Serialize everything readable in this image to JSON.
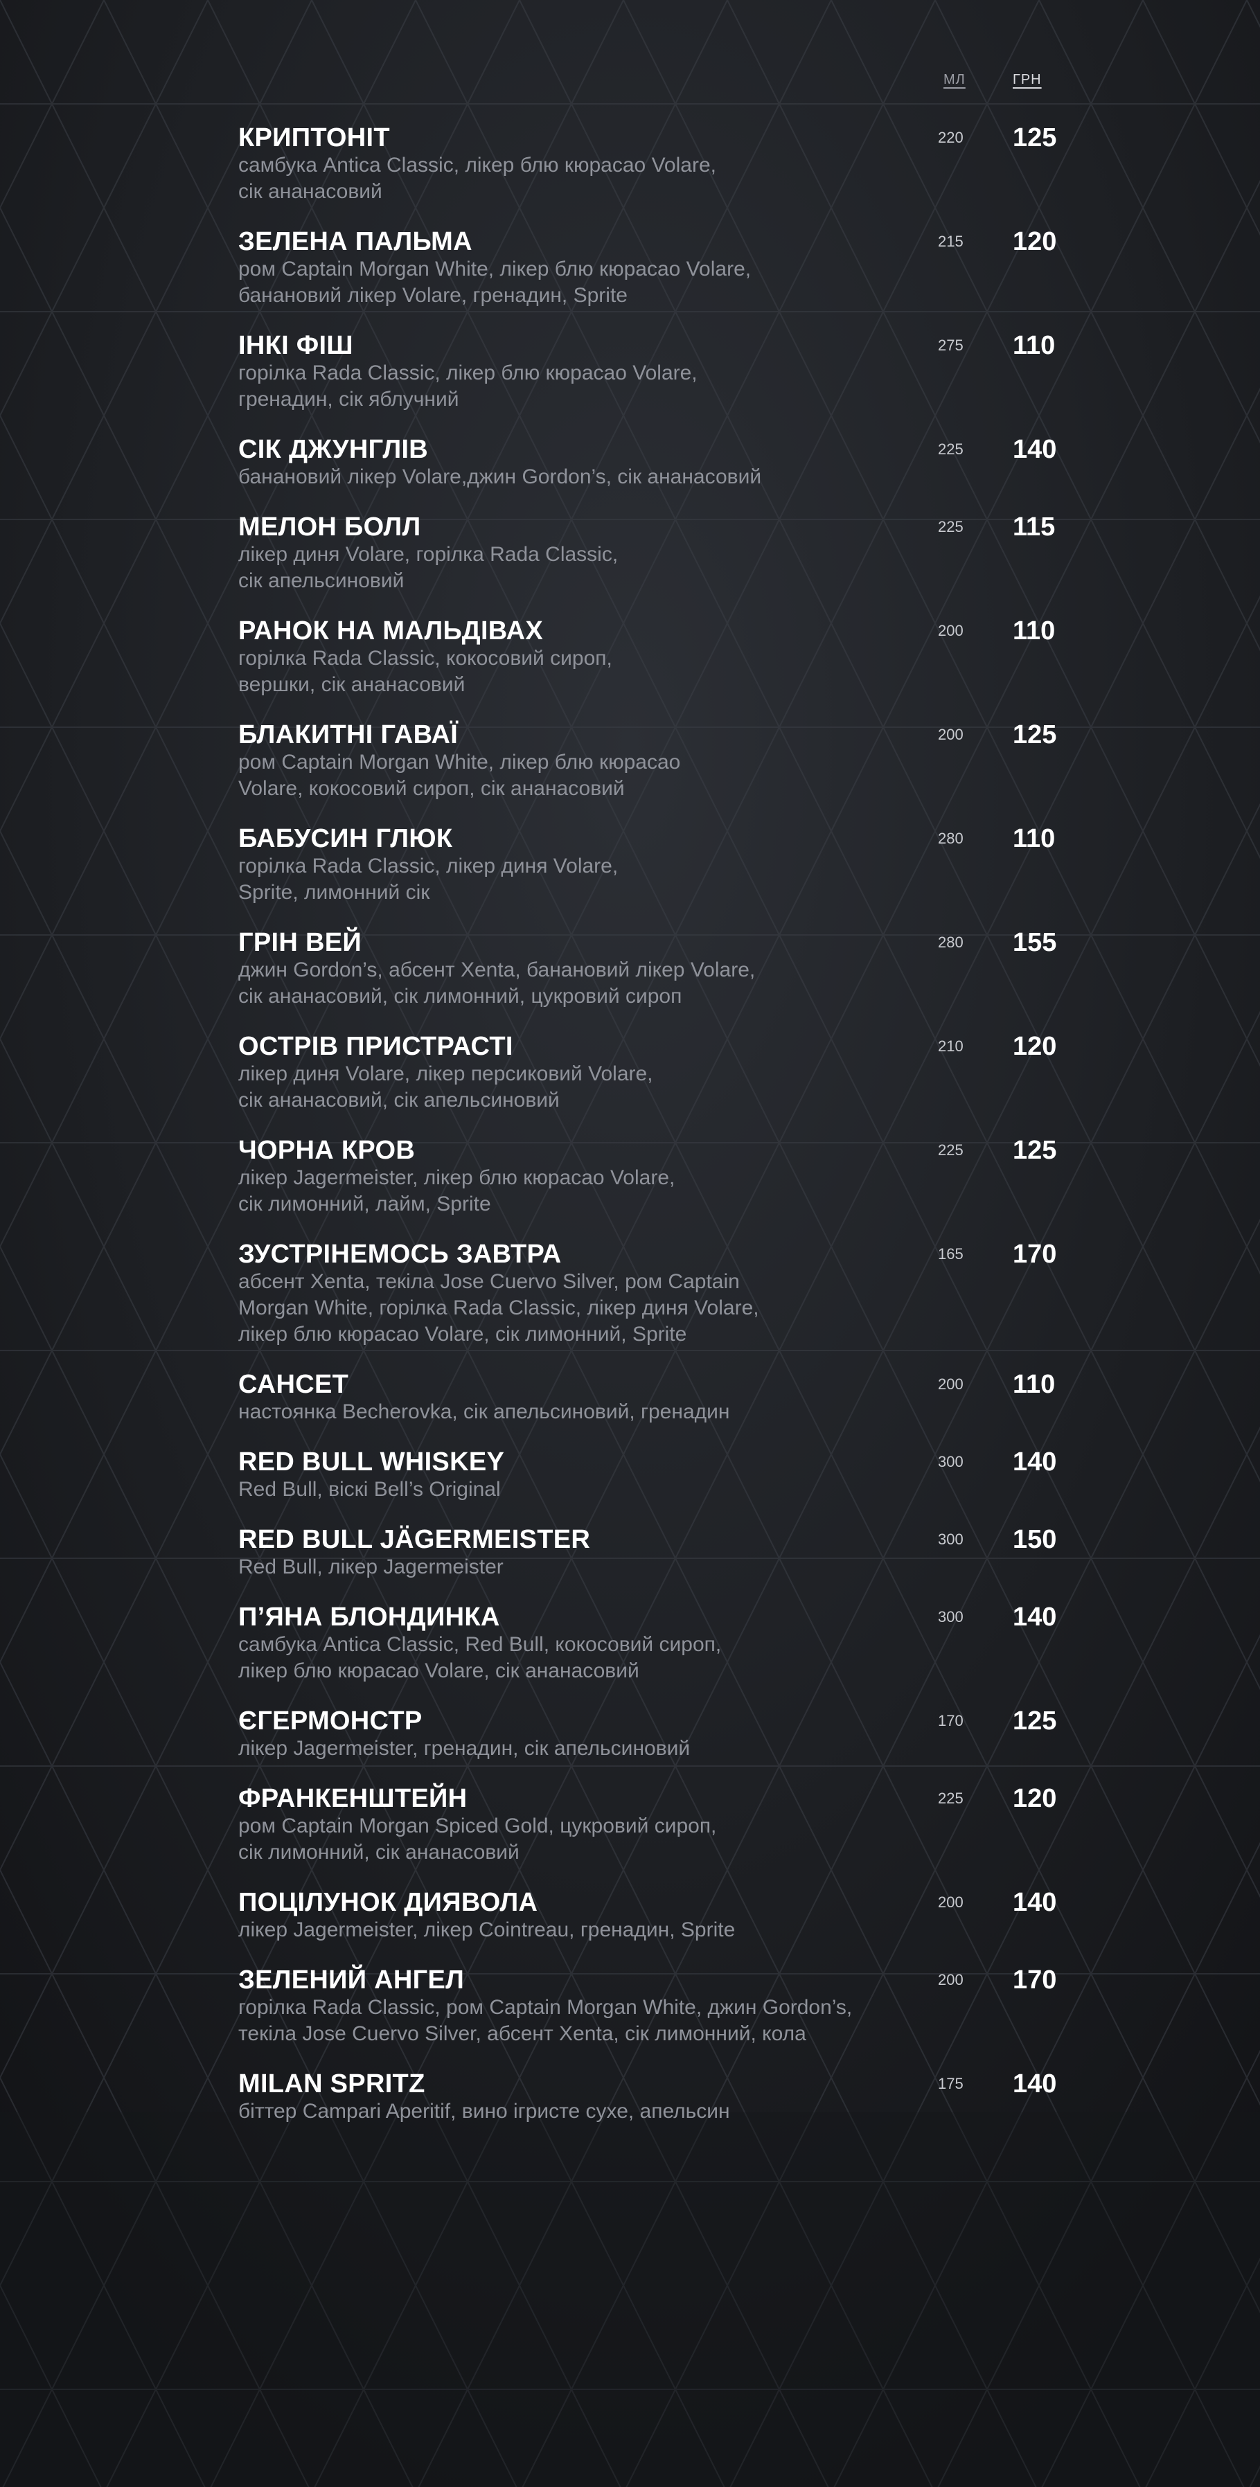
{
  "header": {
    "volume_label": "МЛ",
    "price_label": "ГРН"
  },
  "items": [
    {
      "name": "КРИПТОНІТ",
      "desc": "самбука Antica Classic, лікер блю кюрасао Volare,\nсік ананасовий",
      "vol": "220",
      "price": "125"
    },
    {
      "name": "ЗЕЛЕНА ПАЛЬМА",
      "desc": "ром Captain Morgan White, лікер блю кюрасао Volare,\nбанановий лікер Volare, гренадин, Sprite",
      "vol": "215",
      "price": "120"
    },
    {
      "name": "ІНКІ ФІШ",
      "desc": "горілка Rada Classic, лікер блю кюрасао Volare,\nгренадин, сік яблучний",
      "vol": "275",
      "price": "110"
    },
    {
      "name": "СІК ДЖУНГЛІВ",
      "desc": "банановий лікер Volare,джин Gordon’s, сік ананасовий",
      "vol": "225",
      "price": "140"
    },
    {
      "name": "МЕЛОН БОЛЛ",
      "desc": "лікер диня Volare, горілка Rada Classic,\nсік апельсиновий",
      "vol": "225",
      "price": "115"
    },
    {
      "name": "РАНОК НА МАЛЬДІВАХ",
      "desc": "горілка Rada Classic, кокосовий сироп,\nвершки, сік ананасовий",
      "vol": "200",
      "price": "110"
    },
    {
      "name": "БЛАКИТНІ ГАВАЇ",
      "desc": "ром Captain Morgan White, лікер блю кюрасао\nVolare, кокосовий сироп, сік ананасовий",
      "vol": "200",
      "price": "125"
    },
    {
      "name": "БАБУСИН ГЛЮК",
      "desc": "горілка Rada Classic, лікер диня Volare,\nSprite, лимонний сік",
      "vol": "280",
      "price": "110"
    },
    {
      "name": "ГРІН ВЕЙ",
      "desc": "джин Gordon’s, абсент Xenta, банановий лікер Volare,\nсік ананасовий, сік лимонний, цукровий сироп",
      "vol": "280",
      "price": "155"
    },
    {
      "name": "ОСТРІВ ПРИСТРАСТІ",
      "desc": "лікер диня Volare, лікер персиковий Volare,\nсік ананасовий, сік апельсиновий",
      "vol": "210",
      "price": "120"
    },
    {
      "name": "ЧОРНА КРОВ",
      "desc": "лікер Jagermeister, лікер блю кюрасао Volare,\nсік лимонний, лайм, Sprite",
      "vol": "225",
      "price": "125"
    },
    {
      "name": "ЗУСТРІНЕМОСЬ ЗАВТРА",
      "desc": "абсент Xenta, текіла Jose Cuervo Silver, ром Captain\nMorgan White, горілка Rada Classic, лікер диня Volare,\nлікер блю кюрасао Volare, сік лимонний, Sprite",
      "vol": "165",
      "price": "170"
    },
    {
      "name": "САНСЕТ",
      "desc": "настоянка Becherovka, сік апельсиновий, гренадин",
      "vol": "200",
      "price": "110"
    },
    {
      "name": "RED BULL WHISKEY",
      "desc": "Red Bull, віскі Bell’s Original",
      "vol": "300",
      "price": "140"
    },
    {
      "name": "RED BULL JÄGERMEISTER",
      "desc": "Red Bull, лікер Jagermeister",
      "vol": "300",
      "price": "150"
    },
    {
      "name": "П’ЯНА БЛОНДИНКА",
      "desc": "самбука Antica Classic, Red Bull, кокосовий сироп,\nлікер блю кюрасао Volare, сік ананасовий",
      "vol": "300",
      "price": "140"
    },
    {
      "name": "ЄГЕРМОНСТР",
      "desc": "лікер Jagermeister, гренадин, сік апельсиновий",
      "vol": "170",
      "price": "125"
    },
    {
      "name": "ФРАНКЕНШТЕЙН",
      "desc": "ром Captain Morgan Spiced Gold, цукровий сироп,\nсік лимонний, сік ананасовий",
      "vol": "225",
      "price": "120"
    },
    {
      "name": "ПОЦІЛУНОК ДИЯВОЛА",
      "desc": "лікер Jagermeister, лікер Cointreau, гренадин, Sprite",
      "vol": "200",
      "price": "140"
    },
    {
      "name": "ЗЕЛЕНИЙ АНГЕЛ",
      "desc": "горілка Rada Classic, ром Captain Morgan White, джин Gordon’s,\nтекіла Jose Cuervo Silver, абсент Xenta, сік лимонний, кола",
      "vol": "200",
      "price": "170"
    },
    {
      "name": "MILAN SPRITZ",
      "desc": "біттер Campari Aperitif, вино ігристе сухе, апельсин",
      "vol": "175",
      "price": "140"
    }
  ]
}
